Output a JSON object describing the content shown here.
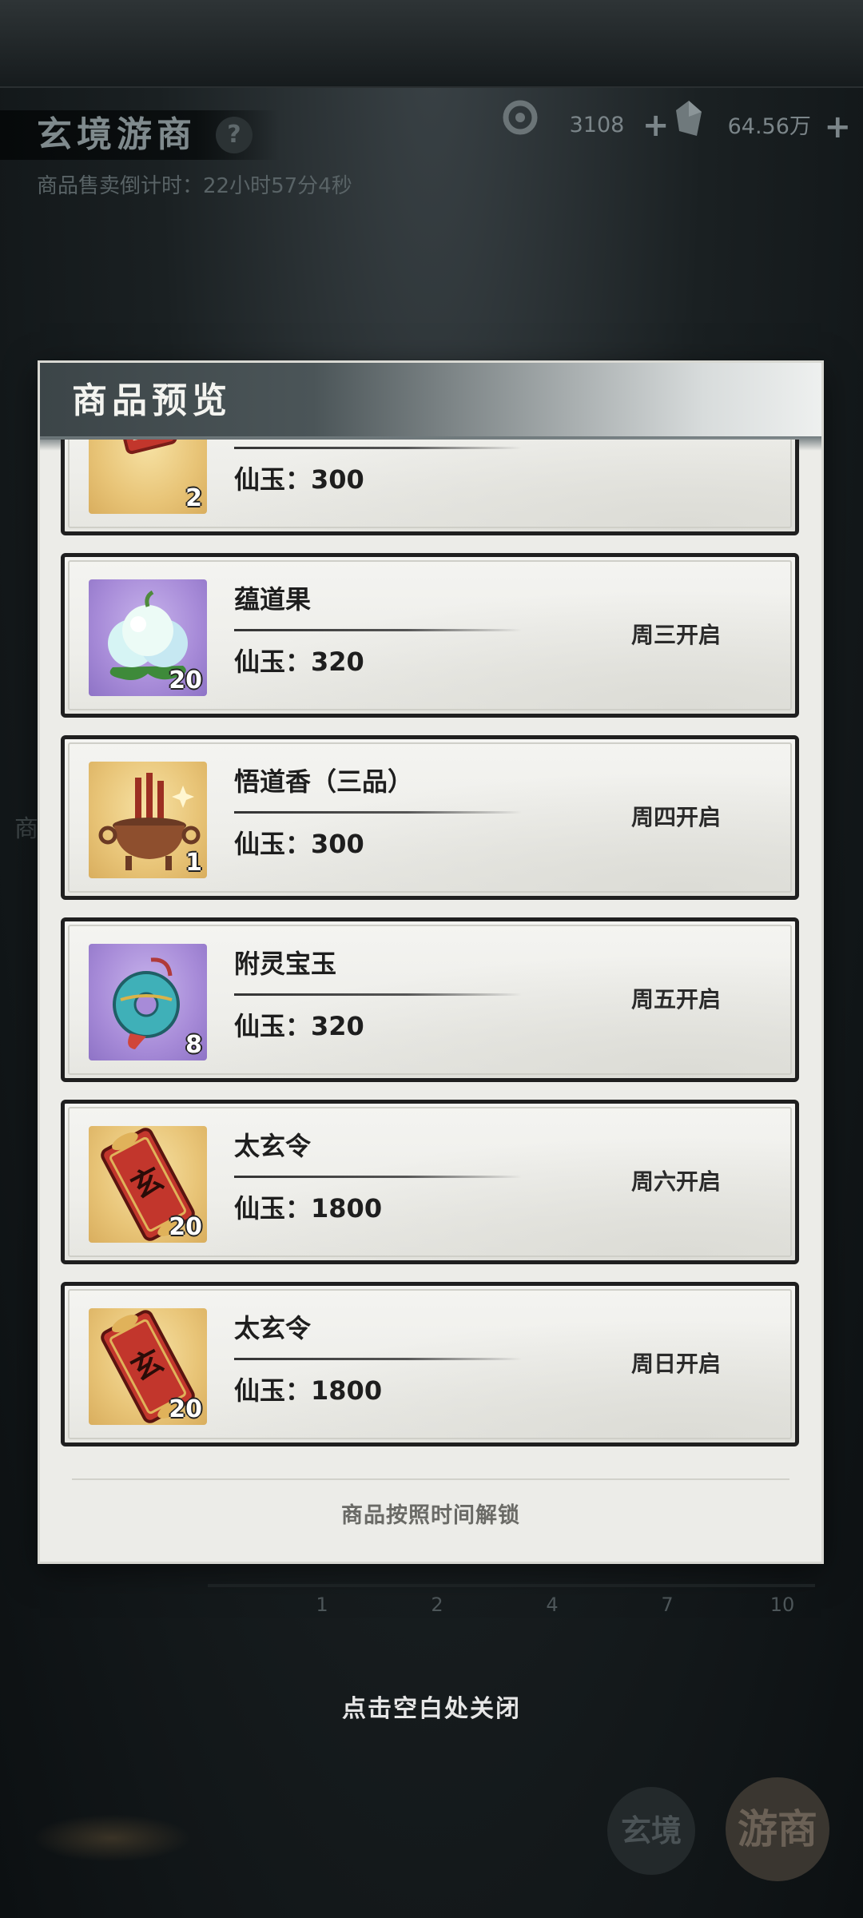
{
  "shop": {
    "title": "玄境游商",
    "help_icon": "?",
    "countdown": "商品售卖倒计时：22小时57分4秒",
    "currencies": [
      {
        "icon": "jade-coin-icon",
        "value": "3108",
        "plus": "+"
      },
      {
        "icon": "spirit-stone-icon",
        "value": "64.56万",
        "plus": "+"
      }
    ],
    "side_label": "商",
    "progress_marks": [
      "1",
      "2",
      "4",
      "7",
      "10"
    ],
    "close_hint": "点击空白处关闭",
    "nav": {
      "xuan": "玄境",
      "you": "游商"
    }
  },
  "modal": {
    "title": "商品预览",
    "footer": "商品按照时间解锁",
    "items": [
      {
        "name": "",
        "price_label": "仙玉：",
        "price": "300",
        "qty": "2",
        "unlock": "",
        "icon": "token-card-icon",
        "tile": "gold"
      },
      {
        "name": "蕴道果",
        "price_label": "仙玉：",
        "price": "320",
        "qty": "20",
        "unlock": "周三开启",
        "icon": "dao-fruit-icon",
        "tile": "purple"
      },
      {
        "name": "悟道香（三品）",
        "price_label": "仙玉：",
        "price": "300",
        "qty": "1",
        "unlock": "周四开启",
        "icon": "incense-burner-icon",
        "tile": "gold"
      },
      {
        "name": "附灵宝玉",
        "price_label": "仙玉：",
        "price": "320",
        "qty": "8",
        "unlock": "周五开启",
        "icon": "jade-pendant-icon",
        "tile": "purple"
      },
      {
        "name": "太玄令",
        "price_label": "仙玉：",
        "price": "1800",
        "qty": "20",
        "unlock": "周六开启",
        "icon": "taixuan-token-icon",
        "tile": "gold"
      },
      {
        "name": "太玄令",
        "price_label": "仙玉：",
        "price": "1800",
        "qty": "20",
        "unlock": "周日开启",
        "icon": "taixuan-token-icon",
        "tile": "gold"
      }
    ],
    "token_glyph": "玄"
  },
  "colors": {
    "modal_bg": "#ecece8",
    "card_border": "#1f1f1f",
    "gold_tile": "#e8c477",
    "purple_tile": "#a78bd8"
  }
}
